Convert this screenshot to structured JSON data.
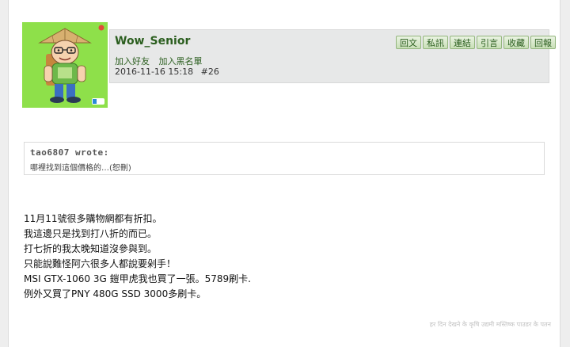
{
  "post": {
    "username": "Wow_Senior",
    "user_links": [
      "加入好友",
      "加入黑名單"
    ],
    "timestamp": "2016-11-16 15:18",
    "floor": "#26",
    "actions": [
      "回文",
      "私訊",
      "連結",
      "引言",
      "收藏",
      "回報"
    ]
  },
  "quote": {
    "author": "tao6807 wrote:",
    "text": "哪裡找到這個價格的…(恕刪)"
  },
  "content": {
    "lines": [
      "11月11號很多購物網都有折扣。",
      "我這邊只是找到打八折的而已。",
      "打七折的我太晚知道沒參與到。",
      "只能說難怪阿六很多人都說要剁手！",
      "MSI GTX-1060 3G 鎧甲虎我也買了一張。5789刷卡.",
      "例外又買了PNY 480G SSD 3000多刷卡。"
    ]
  },
  "footer": {
    "watermark": "हर दिन देखने के कृषि उद्यमी मस्तिष्क पाउडर के पतन"
  },
  "colors": {
    "accent": "#2b5e1f",
    "header_bg": "#e7e8e8",
    "avatar_bg": "#8ee04a"
  }
}
